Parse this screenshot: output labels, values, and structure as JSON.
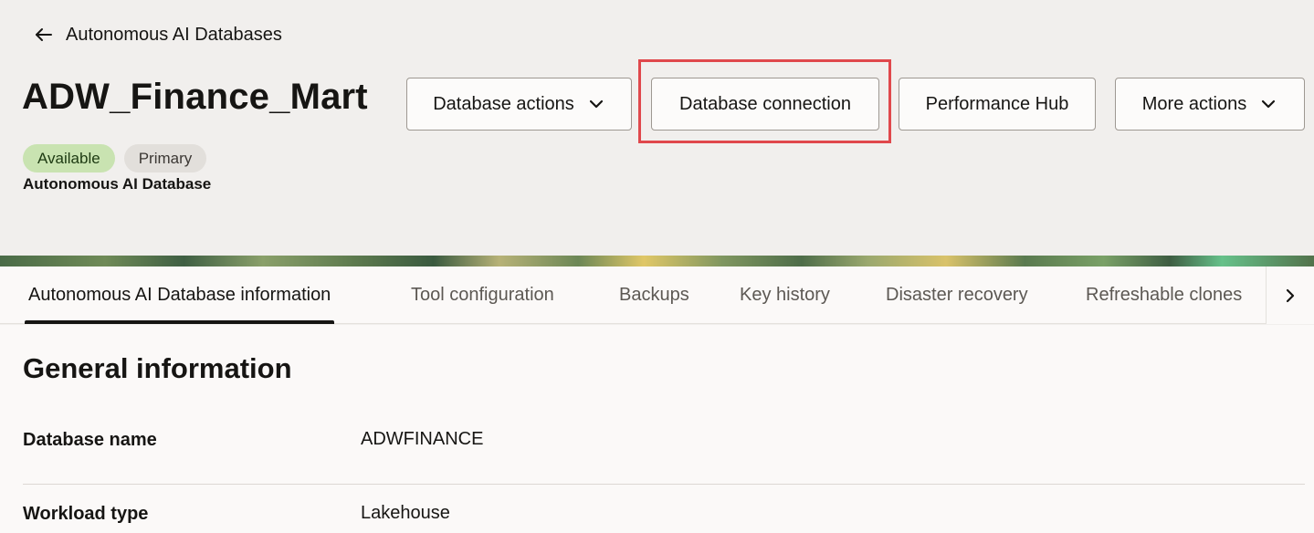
{
  "header": {
    "back_label": "Autonomous AI Databases",
    "title": "ADW_Finance_Mart",
    "badges": {
      "status": "Available",
      "role": "Primary"
    },
    "subtype": "Autonomous AI Database"
  },
  "actions": {
    "database_actions": "Database actions",
    "database_connection": "Database connection",
    "performance_hub": "Performance Hub",
    "more_actions": "More actions"
  },
  "tabs": [
    {
      "label": "Autonomous AI Database information",
      "active": true
    },
    {
      "label": "Tool configuration"
    },
    {
      "label": "Backups"
    },
    {
      "label": "Key history"
    },
    {
      "label": "Disaster recovery"
    },
    {
      "label": "Refreshable clones"
    }
  ],
  "general_info": {
    "title": "General information",
    "rows": [
      {
        "label": "Database name",
        "value": "ADWFINANCE"
      },
      {
        "label": "Workload type",
        "value": "Lakehouse"
      }
    ]
  },
  "colors": {
    "highlight": "#e0484c",
    "badge_available": "#c9e3b1",
    "badge_primary": "#e2dfdb"
  },
  "icons": [
    "arrow-left-icon",
    "chevron-down-icon",
    "chevron-right-icon"
  ]
}
